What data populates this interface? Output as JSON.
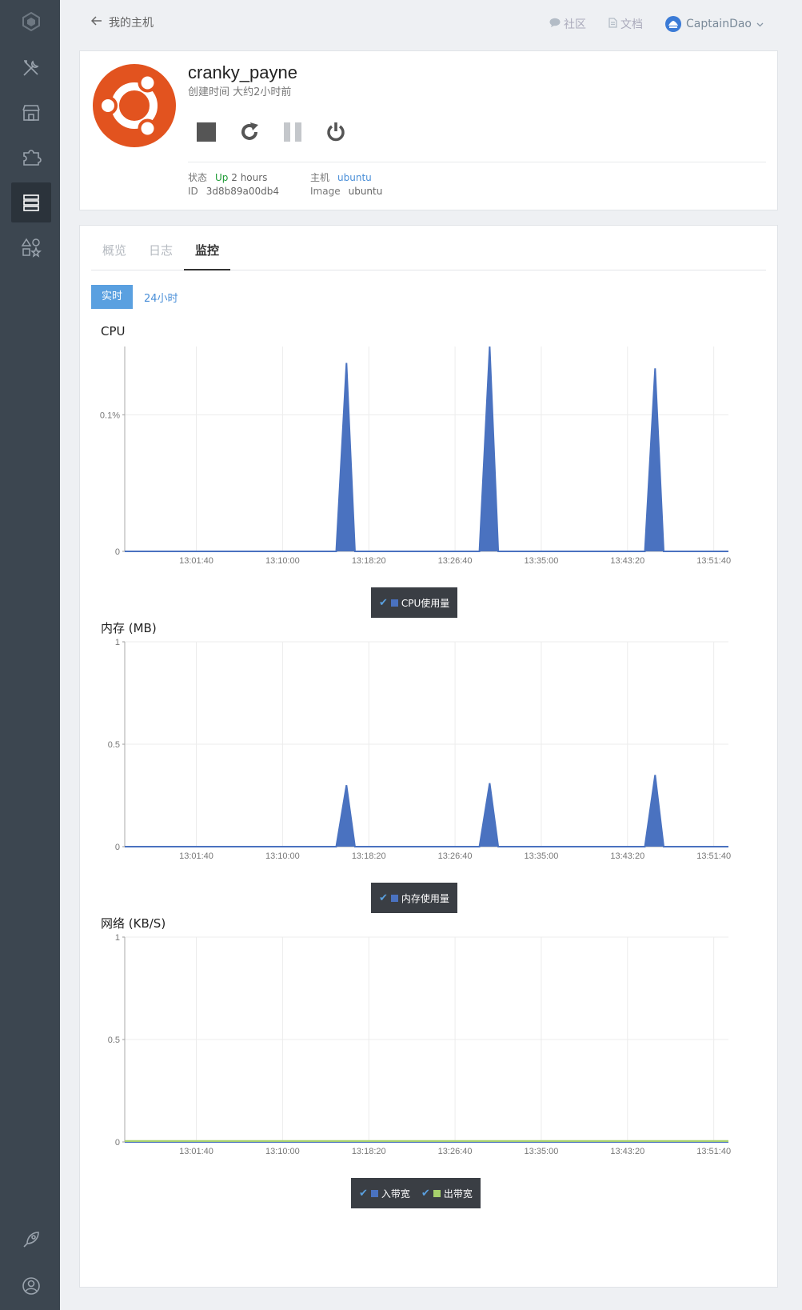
{
  "nav": {
    "back_label": "我的主机"
  },
  "top": {
    "community": "社区",
    "docs": "文档",
    "user": "CaptainDao"
  },
  "container": {
    "name": "cranky_payne",
    "created": "创建时间 大约2小时前",
    "status_label": "状态",
    "status_value": "Up",
    "status_duration": "2 hours",
    "id_label": "ID",
    "id_value": "3d8b89a00db4",
    "host_label": "主机",
    "host_value": "ubuntu",
    "image_label": "Image",
    "image_value": "ubuntu"
  },
  "tabs": [
    "概览",
    "日志",
    "监控"
  ],
  "range": {
    "realtime": "实时",
    "day": "24小时"
  },
  "colors": {
    "series_blue": "#4a72c0",
    "series_green": "#a6d06c",
    "sidebar": "#3c4650",
    "accent": "#5aa0e0"
  },
  "chart_data": [
    {
      "type": "area",
      "title": "CPU",
      "ytick_labels": [
        "0",
        "0.1%"
      ],
      "yticks": [
        0,
        0.1
      ],
      "ylim": [
        0,
        0.15
      ],
      "xticks": [
        "13:01:40",
        "13:10:00",
        "13:18:20",
        "13:26:40",
        "13:35:00",
        "13:43:20",
        "13:51:40"
      ],
      "x_seconds_range": [
        0,
        3540
      ],
      "grid": true,
      "legend_position": "bottom",
      "series": [
        {
          "name": "CPU使用量",
          "color": "#4a72c0",
          "points": [
            [
              0,
              0
            ],
            [
              1240,
              0
            ],
            [
              1300,
              0.138
            ],
            [
              1350,
              0
            ],
            [
              2080,
              0
            ],
            [
              2140,
              0.15
            ],
            [
              2190,
              0
            ],
            [
              3050,
              0
            ],
            [
              3110,
              0.134
            ],
            [
              3160,
              0
            ],
            [
              3540,
              0
            ]
          ]
        }
      ]
    },
    {
      "type": "area",
      "title": "内存 (MB)",
      "ytick_labels": [
        "0",
        "0.5",
        "1"
      ],
      "yticks": [
        0,
        0.5,
        1
      ],
      "ylim": [
        0,
        1
      ],
      "xticks": [
        "13:01:40",
        "13:10:00",
        "13:18:20",
        "13:26:40",
        "13:35:00",
        "13:43:20",
        "13:51:40"
      ],
      "x_seconds_range": [
        0,
        3540
      ],
      "grid": true,
      "legend_position": "bottom",
      "series": [
        {
          "name": "内存使用量",
          "color": "#4a72c0",
          "points": [
            [
              0,
              0
            ],
            [
              1240,
              0
            ],
            [
              1300,
              0.3
            ],
            [
              1350,
              0
            ],
            [
              2080,
              0
            ],
            [
              2140,
              0.31
            ],
            [
              2190,
              0
            ],
            [
              3050,
              0
            ],
            [
              3110,
              0.35
            ],
            [
              3160,
              0
            ],
            [
              3540,
              0
            ]
          ]
        }
      ]
    },
    {
      "type": "area",
      "title": "网络 (KB/S)",
      "ytick_labels": [
        "0",
        "0.5",
        "1"
      ],
      "yticks": [
        0,
        0.5,
        1
      ],
      "ylim": [
        0,
        1
      ],
      "xticks": [
        "13:01:40",
        "13:10:00",
        "13:18:20",
        "13:26:40",
        "13:35:00",
        "13:43:20",
        "13:51:40"
      ],
      "x_seconds_range": [
        0,
        3540
      ],
      "grid": true,
      "legend_position": "bottom",
      "series": [
        {
          "name": "入带宽",
          "color": "#4a72c0",
          "points": [
            [
              0,
              0
            ],
            [
              3540,
              0
            ]
          ]
        },
        {
          "name": "出带宽",
          "color": "#a6d06c",
          "points": [
            [
              0,
              0.005
            ],
            [
              3540,
              0.005
            ]
          ]
        }
      ]
    }
  ]
}
